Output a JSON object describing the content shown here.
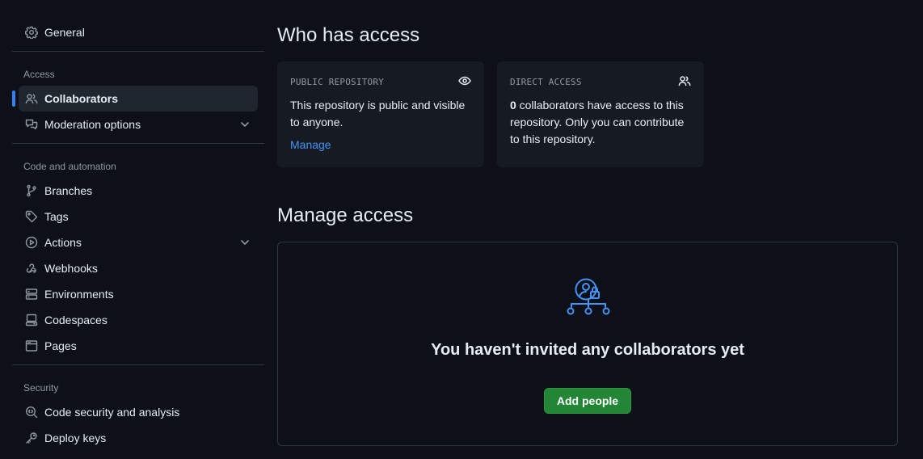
{
  "sidebar": {
    "general": {
      "label": "General",
      "icon": "gear-icon"
    },
    "sections": {
      "access": {
        "title": "Access",
        "items": [
          {
            "label": "Collaborators",
            "icon": "people-icon",
            "active": true
          },
          {
            "label": "Moderation options",
            "icon": "comment-discussion-icon",
            "expandable": true
          }
        ]
      },
      "code": {
        "title": "Code and automation",
        "items": [
          {
            "label": "Branches",
            "icon": "git-branch-icon"
          },
          {
            "label": "Tags",
            "icon": "tag-icon"
          },
          {
            "label": "Actions",
            "icon": "play-icon",
            "expandable": true
          },
          {
            "label": "Webhooks",
            "icon": "webhook-icon"
          },
          {
            "label": "Environments",
            "icon": "server-icon"
          },
          {
            "label": "Codespaces",
            "icon": "codespaces-icon"
          },
          {
            "label": "Pages",
            "icon": "browser-icon"
          }
        ]
      },
      "security": {
        "title": "Security",
        "items": [
          {
            "label": "Code security and analysis",
            "icon": "codescan-icon"
          },
          {
            "label": "Deploy keys",
            "icon": "key-icon"
          }
        ]
      }
    }
  },
  "main": {
    "who_has_access": {
      "title": "Who has access",
      "public_card": {
        "kicker": "PUBLIC REPOSITORY",
        "icon": "eye-icon",
        "body": "This repository is public and visible to anyone.",
        "link": "Manage"
      },
      "direct_card": {
        "kicker": "DIRECT ACCESS",
        "icon": "people-icon",
        "count": "0",
        "body_rest": " collaborators have access to this repository. Only you can contribute to this repository."
      }
    },
    "manage_access": {
      "title": "Manage access",
      "blank_icon": "person-lock-network-icon",
      "blank_title": "You haven't invited any collaborators yet",
      "button": "Add people"
    }
  },
  "colors": {
    "background": "#0d1117",
    "card": "#161b22",
    "border": "#30363d",
    "accent": "#2f81f7",
    "link": "#4493f8",
    "primary_button": "#238636",
    "muted_text": "#9198a1"
  }
}
